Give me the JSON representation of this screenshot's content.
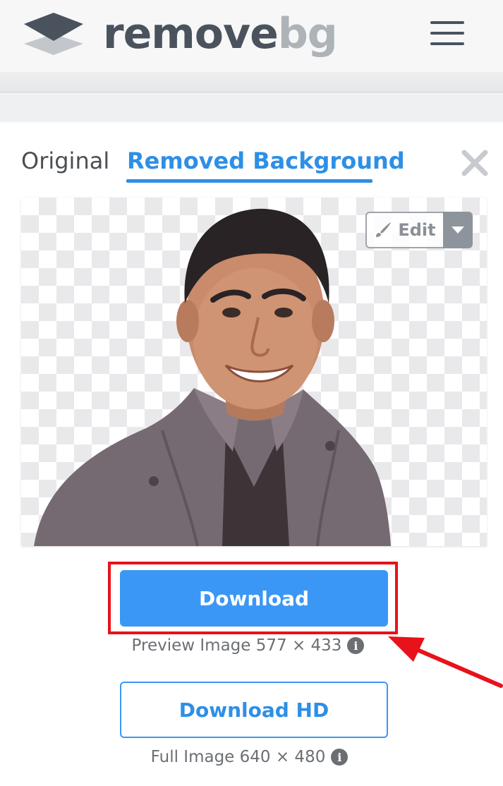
{
  "header": {
    "brand_part1": "remove",
    "brand_part2": "bg",
    "logo_icon": "layers-icon",
    "menu_icon": "hamburger-menu-icon"
  },
  "tabs": [
    {
      "label": "Original",
      "active": false
    },
    {
      "label": "Removed Background",
      "active": true
    }
  ],
  "preview": {
    "edit_label": "Edit",
    "edit_icon": "brush-icon",
    "edit_dropdown_icon": "caret-down-icon"
  },
  "downloads": {
    "primary_label": "Download",
    "preview_info": "Preview Image 577 × 433",
    "hd_label": "Download HD",
    "full_info": "Full Image 640 × 480"
  },
  "colors": {
    "accent": "#3b97f6",
    "brand_dark": "#4a535d",
    "brand_light": "#aeb3b8",
    "highlight": "#e8121a"
  }
}
